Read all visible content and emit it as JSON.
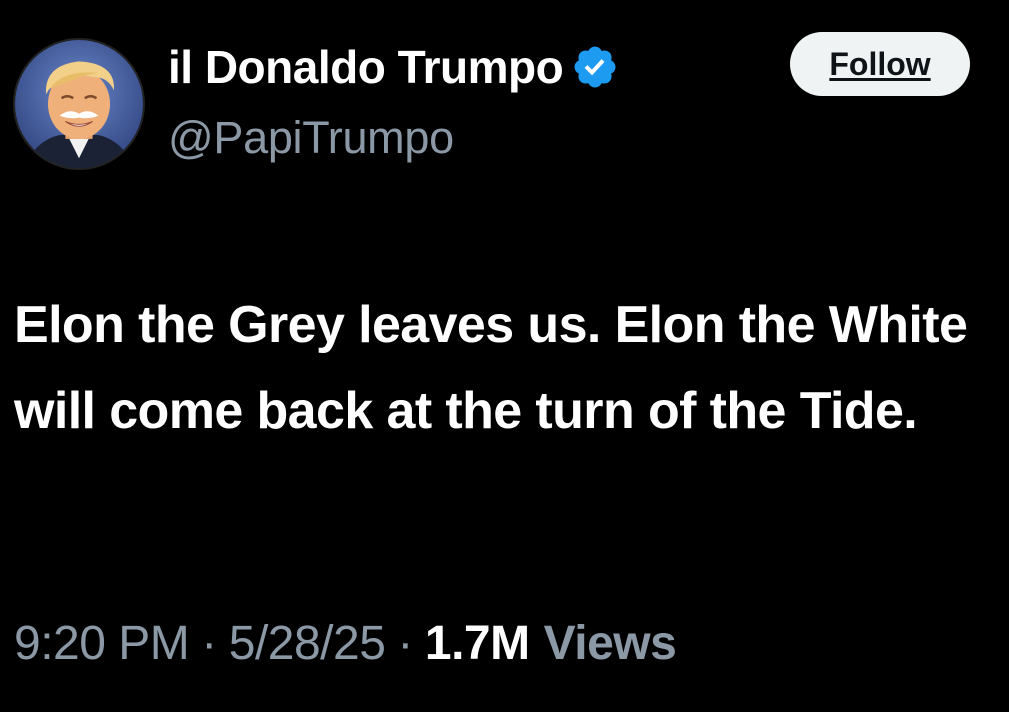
{
  "author": {
    "display_name": "il Donaldo Trumpo",
    "handle": "@PapiTrumpo",
    "verified_icon": "verified-badge-icon",
    "avatar_icon": "avatar-portrait"
  },
  "follow_button": {
    "label": "Follow"
  },
  "tweet": {
    "text": "Elon the Grey leaves us. Elon the White will come back at the turn of the Tide."
  },
  "meta": {
    "time": "9:20 PM",
    "separator": "·",
    "date": "5/28/25",
    "views_count": "1.7M",
    "views_label": "Views"
  },
  "colors": {
    "background": "#000000",
    "text_primary": "#ffffff",
    "text_secondary": "#8b98a5",
    "verified_blue": "#1d9bf0",
    "button_bg": "#eff3f4",
    "button_text": "#0f1419"
  }
}
